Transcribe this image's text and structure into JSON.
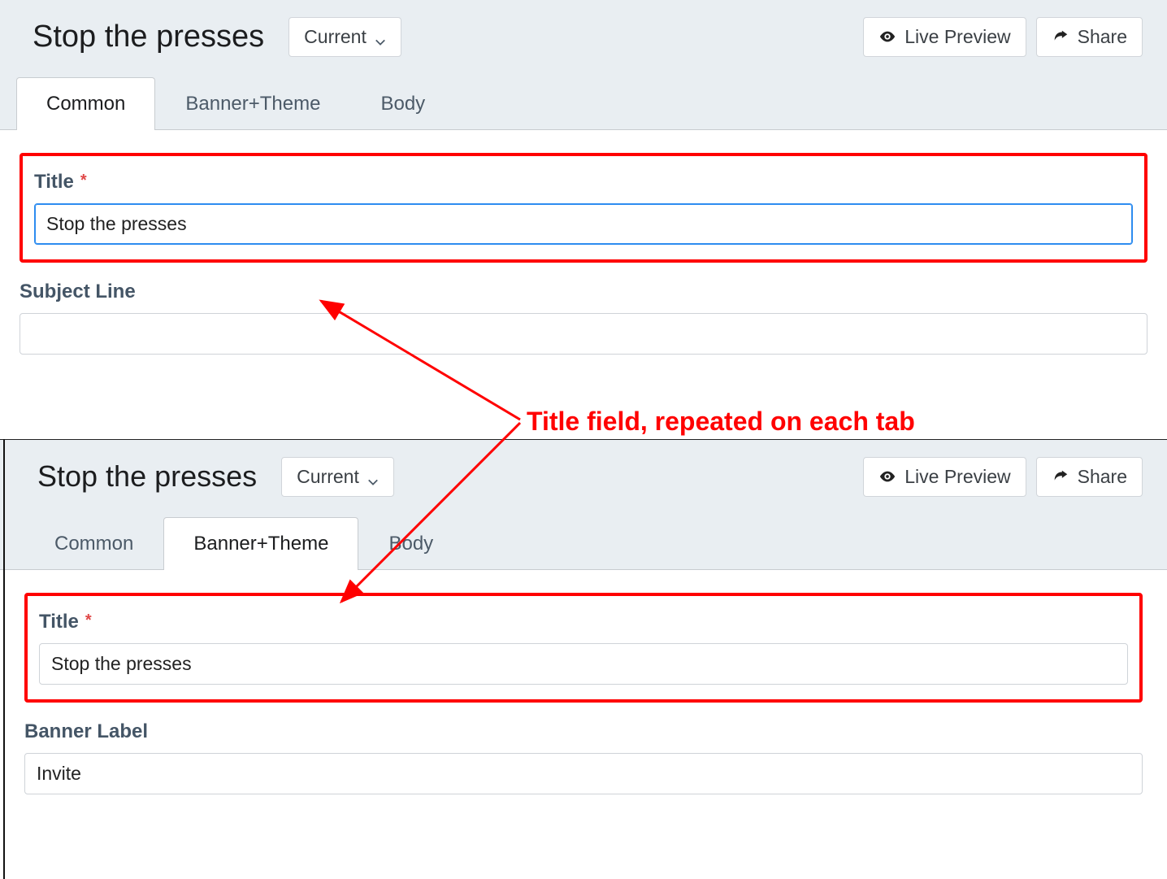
{
  "annotation": {
    "text": "Title field, repeated on each tab"
  },
  "top": {
    "header": {
      "title": "Stop the presses",
      "version_label": "Current",
      "actions": {
        "preview": "Live Preview",
        "share": "Share"
      }
    },
    "tabs": {
      "common": "Common",
      "banner_theme": "Banner+Theme",
      "body": "Body",
      "active": "common"
    },
    "form": {
      "title_label": "Title",
      "title_value": "Stop the presses",
      "subject_label": "Subject Line",
      "subject_value": ""
    }
  },
  "bottom": {
    "header": {
      "title": "Stop the presses",
      "version_label": "Current",
      "actions": {
        "preview": "Live Preview",
        "share": "Share"
      }
    },
    "tabs": {
      "common": "Common",
      "banner_theme": "Banner+Theme",
      "body": "Body",
      "active": "banner_theme"
    },
    "form": {
      "title_label": "Title",
      "title_value": "Stop the presses",
      "banner_label_label": "Banner Label",
      "banner_label_value": "Invite"
    }
  }
}
